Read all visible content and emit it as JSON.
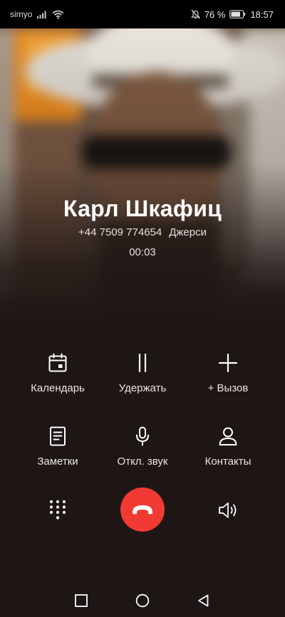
{
  "status_bar": {
    "carrier": "simyo",
    "battery": "76 %",
    "time": "18:57",
    "icons": [
      "signal-icon",
      "wifi-icon",
      "do-not-disturb-icon",
      "battery-icon"
    ]
  },
  "caller": {
    "name": "Карл Шкафиц",
    "phone": "+44 7509 774654",
    "location": "Джерси",
    "duration": "00:03"
  },
  "actions": [
    {
      "label": "Календарь",
      "icon": "calendar-icon"
    },
    {
      "label": "Удержать",
      "icon": "pause-icon"
    },
    {
      "label": "+ Вызов",
      "icon": "plus-icon"
    },
    {
      "label": "Заметки",
      "icon": "notes-icon"
    },
    {
      "label": "Откл. звук",
      "icon": "microphone-icon"
    },
    {
      "label": "Контакты",
      "icon": "contact-icon"
    }
  ],
  "controls": {
    "dialpad_icon": "dialpad-icon",
    "end_call_icon": "end-call-icon",
    "speaker_icon": "speaker-icon",
    "end_call_color": "#f23a34"
  },
  "nav_bar": {
    "icons": [
      "recents-square-icon",
      "home-circle-icon",
      "back-triangle-icon"
    ]
  },
  "colors": {
    "background": "#1e1614",
    "status_bar": "#000000",
    "text": "#ffffff"
  }
}
